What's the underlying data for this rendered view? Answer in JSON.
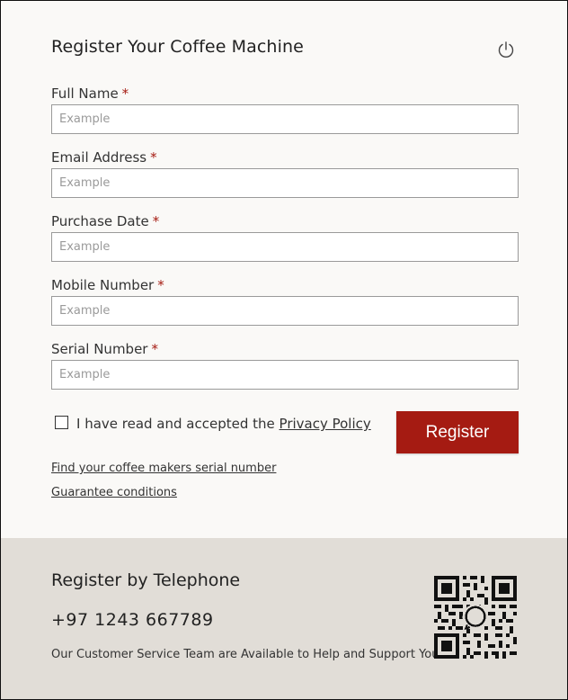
{
  "form": {
    "title": "Register Your Coffee Machine",
    "required_marker": "*",
    "fields": [
      {
        "label": "Full Name",
        "placeholder": "Example"
      },
      {
        "label": "Email Address",
        "placeholder": "Example"
      },
      {
        "label": "Purchase Date",
        "placeholder": "Example"
      },
      {
        "label": "Mobile Number",
        "placeholder": "Example"
      },
      {
        "label": "Serial Number",
        "placeholder": "Example"
      }
    ],
    "consent_text": "I have read and accepted the",
    "privacy_link": "Privacy Policy",
    "register_label": "Register",
    "links": {
      "serial": "Find your coffee makers serial number",
      "guarantee": "Guarantee conditions"
    }
  },
  "footer": {
    "title": "Register by Telephone",
    "phone": "+97 1243 667789",
    "support_text": "Our Customer Service Team are Available to Help and Support You."
  },
  "icons": {
    "power": "power-icon",
    "qr": "qr-code-icon",
    "whatsapp": "whatsapp-icon"
  },
  "colors": {
    "accent": "#a51b12",
    "footer_bg": "#e1ddd7",
    "page_bg": "#faf9f7"
  }
}
